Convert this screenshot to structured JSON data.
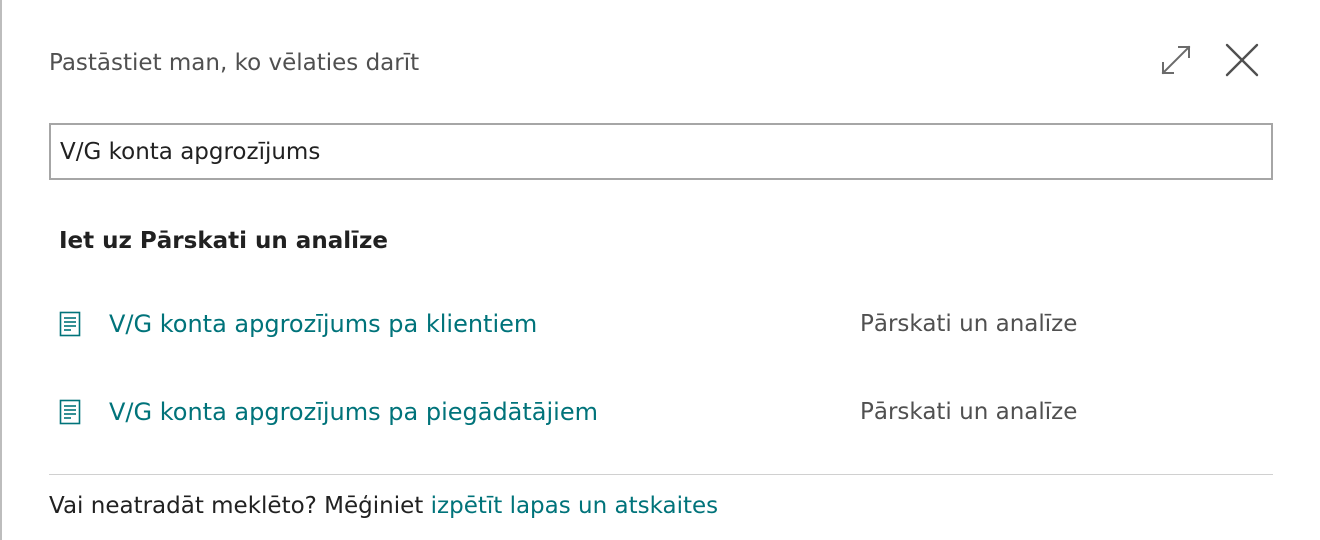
{
  "dialog": {
    "title": "Pastāstiet man, ko vēlaties darīt",
    "expand_icon": "expand-icon",
    "close_icon": "close-icon"
  },
  "search": {
    "value": "V/G konta apgrozījums"
  },
  "results": {
    "heading": "Iet uz Pārskati un analīze",
    "items": [
      {
        "name": "V/G konta apgrozījums pa klientiem",
        "category": "Pārskati un analīze",
        "icon": "report-icon"
      },
      {
        "name": "V/G konta apgrozījums pa piegādātājiem",
        "category": "Pārskati un analīze",
        "icon": "report-icon"
      }
    ]
  },
  "footer": {
    "text": "Vai neatradāt meklēto? Mēģiniet",
    "link_label": "izpētīt lapas un atskaites"
  },
  "colors": {
    "accent": "#00737a",
    "text": "#212121",
    "secondary_text": "#505050",
    "border": "#a6a6a6"
  }
}
